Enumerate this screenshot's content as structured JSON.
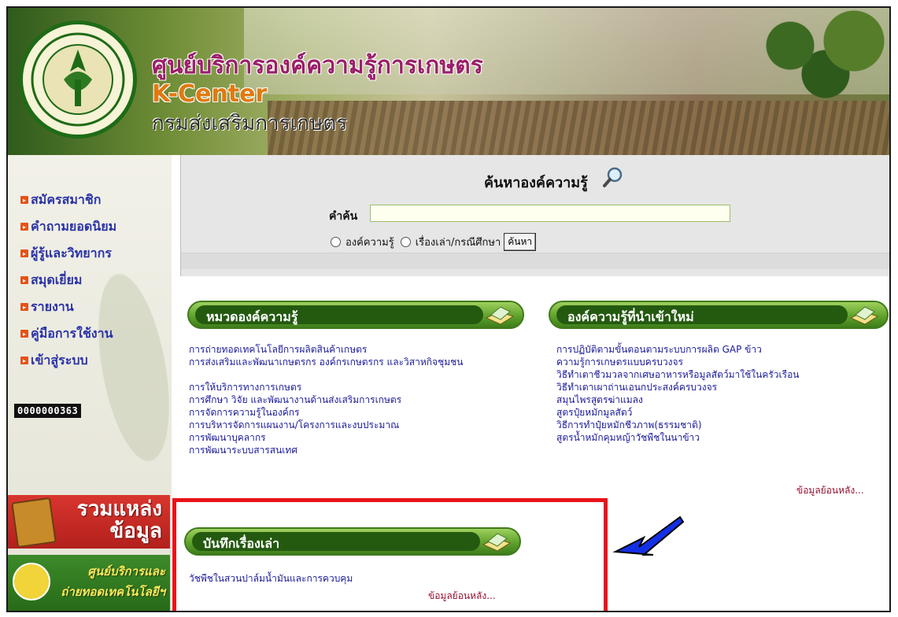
{
  "header": {
    "title_th": "ศูนย์บริการองค์ความรู้การเกษตร",
    "title_en": "K-Center",
    "department": "กรมส่งเสริมการเกษตร",
    "seal_label": "กรมส่งเสริมการเกษตร"
  },
  "sidebar": {
    "items": [
      {
        "label": "สมัครสมาชิก"
      },
      {
        "label": "คำถามยอดนิยม"
      },
      {
        "label": "ผู้รู้และวิทยากร"
      },
      {
        "label": "สมุดเยี่ยม"
      },
      {
        "label": "รายงาน"
      },
      {
        "label": "คู่มือการใช้งาน"
      },
      {
        "label": "เข้าสู่ระบบ"
      }
    ],
    "counter": "0000000363",
    "banner1_line1": "รวมแหล่ง",
    "banner1_line2": "ข้อมูล",
    "banner2_line1": "ศูนย์บริการและ",
    "banner2_line2": "ถ่ายทอดเทคโนโลยีฯ"
  },
  "search": {
    "heading": "ค้นหาองค์ความรู้",
    "label": "คำค้น",
    "value": "",
    "option1": "องค์ความรู้",
    "option2": "เรื่องเล่า/กรณีศึกษา",
    "button": "ค้นหา"
  },
  "categories": {
    "title": "หมวดองค์ความรู้",
    "items": [
      "การถ่ายทอดเทคโนโลยีการผลิตสินค้าเกษตร",
      "การส่งเสริมและพัฒนาเกษตรกร องค์กรเกษตรกร และวิสาหกิจชุมชน",
      "การให้บริการทางการเกษตร",
      "การศึกษา วิจัย และพัฒนางานด้านส่งเสริมการเกษตร",
      "การจัดการความรู้ในองค์กร",
      "การบริหารจัดการแผนงาน/โครงการและงบประมาณ",
      "การพัฒนาบุคลากร",
      "การพัฒนาระบบสารสนเทศ"
    ]
  },
  "new_knowledge": {
    "title": "องค์ความรู้ที่นำเข้าใหม่",
    "items": [
      "การปฏิบัติตามขั้นตอนตามระบบการผลิต GAP ข้าว",
      "ความรู้การเกษตรแบบครบวงจร",
      "วิธีทำเตาชีวมวลจากเศษอาหารหรือมูลสัตว์มาใช้ในครัวเรือน",
      "วิธีทำเตาเผาถ่านเอนกประสงค์ครบวงจร",
      "สมุนไพรสูตรฆ่าแมลง",
      "สูตรปุ๋ยหมักมูลสัตว์",
      "วิธีการทำปุ๋ยหมักชีวภาพ(ธรรมชาติ)",
      "สูตรน้ำหมักคุมหญ้าวัชพืชในนาข้าว"
    ],
    "more": "ข้อมูลย้อนหลัง..."
  },
  "stories": {
    "title": "บันทึกเรื่องเล่า",
    "items": [
      "วัชพืชในสวนปาล์มน้ำมันและการควบคุม"
    ],
    "more": "ข้อมูลย้อนหลัง..."
  },
  "colors": {
    "highlight": "#e8141a",
    "arrow": "#1430e6",
    "link": "#1a1a9a",
    "menu": "#2a33a8"
  }
}
